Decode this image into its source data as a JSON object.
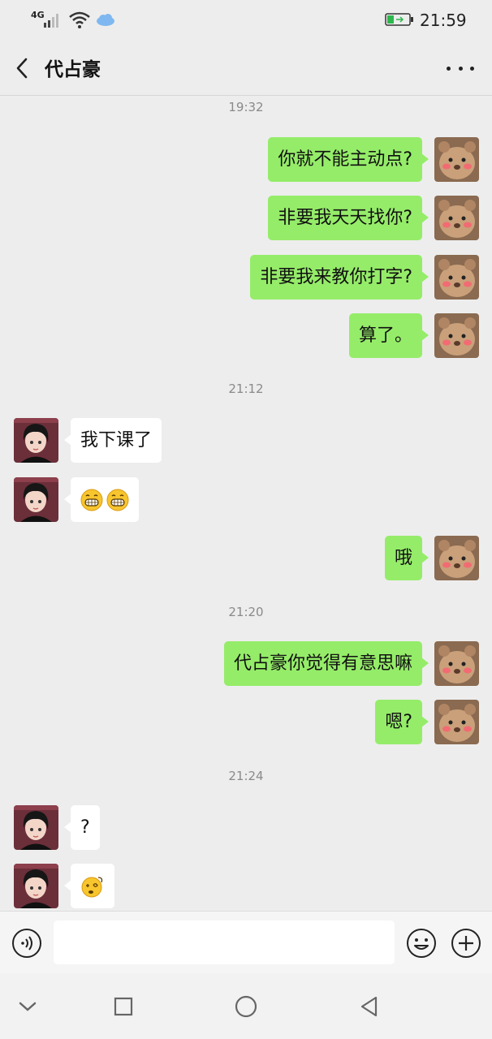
{
  "status_bar": {
    "network": "4G",
    "time": "21:59"
  },
  "header": {
    "title": "代占豪"
  },
  "messages": [
    {
      "kind": "time",
      "text": "19:32"
    },
    {
      "kind": "out",
      "text": "你就不能主动点?"
    },
    {
      "kind": "out",
      "text": "非要我天天找你?"
    },
    {
      "kind": "out",
      "text": "非要我来教你打字?"
    },
    {
      "kind": "out",
      "text": "算了。"
    },
    {
      "kind": "time",
      "text": "21:12"
    },
    {
      "kind": "in",
      "text": "我下课了"
    },
    {
      "kind": "in",
      "emoji": [
        "grin-emoji",
        "grin-emoji"
      ]
    },
    {
      "kind": "out",
      "text": "哦"
    },
    {
      "kind": "time",
      "text": "21:20"
    },
    {
      "kind": "out",
      "text": "代占豪你觉得有意思嘛"
    },
    {
      "kind": "out",
      "text": "嗯?"
    },
    {
      "kind": "time",
      "text": "21:24"
    },
    {
      "kind": "in",
      "text": "?"
    },
    {
      "kind": "in",
      "emoji": [
        "dizzy-emoji"
      ]
    }
  ],
  "input": {
    "value": "",
    "placeholder": ""
  },
  "colors": {
    "outgoing_bubble": "#95ec69",
    "incoming_bubble": "#ffffff",
    "background": "#ededed"
  }
}
